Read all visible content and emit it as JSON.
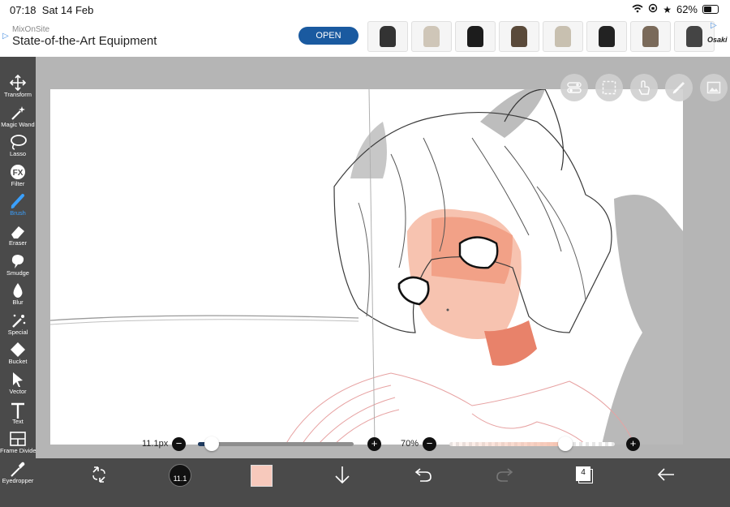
{
  "status": {
    "time": "07:18",
    "date": "Sat 14 Feb",
    "battery": "62%",
    "battery_level": 0.62
  },
  "ad": {
    "sponsor": "MixOnSite",
    "headline": "State-of-the-Art Equipment",
    "button": "OPEN",
    "brand": "Osaki",
    "thumb_colors": [
      "#333333",
      "#cfc6b8",
      "#1c1c1c",
      "#5a4a3a",
      "#c8c0b0",
      "#222222",
      "#7a6a5a",
      "#444444"
    ]
  },
  "tools": [
    {
      "name": "transform",
      "label": "Transform",
      "icon": "transform-icon"
    },
    {
      "name": "magic-wand",
      "label": "Magic Wand",
      "icon": "magic-wand-icon"
    },
    {
      "name": "lasso",
      "label": "Lasso",
      "icon": "lasso-icon"
    },
    {
      "name": "filter",
      "label": "Filter",
      "icon": "filter-fx-icon"
    },
    {
      "name": "brush",
      "label": "Brush",
      "icon": "brush-icon",
      "active": true
    },
    {
      "name": "eraser",
      "label": "Eraser",
      "icon": "eraser-icon"
    },
    {
      "name": "smudge",
      "label": "Smudge",
      "icon": "smudge-icon"
    },
    {
      "name": "blur",
      "label": "Blur",
      "icon": "blur-drop-icon"
    },
    {
      "name": "special",
      "label": "Special",
      "icon": "special-wand-icon"
    },
    {
      "name": "bucket",
      "label": "Bucket",
      "icon": "bucket-icon"
    },
    {
      "name": "vector",
      "label": "Vector",
      "icon": "vector-cursor-icon"
    },
    {
      "name": "text",
      "label": "Text",
      "icon": "text-icon"
    },
    {
      "name": "frame-divider",
      "label": "Frame Divider",
      "icon": "frame-divider-icon"
    },
    {
      "name": "eyedropper",
      "label": "Eyedropper",
      "icon": "eyedropper-icon"
    }
  ],
  "brush": {
    "size_label": "11.1px",
    "size_fraction": 0.09,
    "size_badge": "11.1"
  },
  "opacity": {
    "label": "70%",
    "fraction": 0.7
  },
  "bottom": {
    "layer_count": "4",
    "color_swatch": "#f7c9bc"
  },
  "colors": {
    "accent": "#3aa0ff",
    "toolbar": "#4a4a4a",
    "skin": "#f7c3b0",
    "neck": "#e8826a"
  }
}
